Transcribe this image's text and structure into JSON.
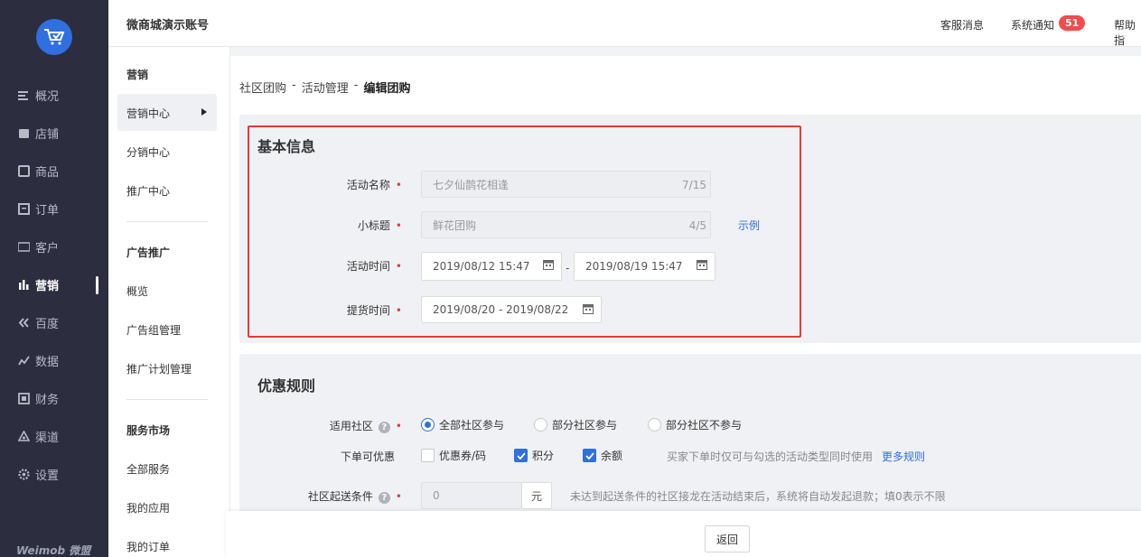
{
  "nav": {
    "items": [
      {
        "label": "概况",
        "icon": "menu-lines-icon"
      },
      {
        "label": "店铺",
        "icon": "store-icon"
      },
      {
        "label": "商品",
        "icon": "goods-icon"
      },
      {
        "label": "订单",
        "icon": "order-icon"
      },
      {
        "label": "客户",
        "icon": "vip-card-icon"
      },
      {
        "label": "营销",
        "icon": "bar-chart-icon"
      },
      {
        "label": "百度",
        "icon": "baidu-icon"
      },
      {
        "label": "数据",
        "icon": "line-chart-icon"
      },
      {
        "label": "财务",
        "icon": "finance-icon"
      },
      {
        "label": "渠道",
        "icon": "channel-icon"
      },
      {
        "label": "设置",
        "icon": "gear-icon"
      }
    ],
    "brand": "Weimob 微盟"
  },
  "header": {
    "account": "微商城演示账号",
    "service": "客服消息",
    "notice": "系统通知",
    "notice_count": "51",
    "help": "帮助指"
  },
  "subnav": {
    "group1": "营销",
    "items1": [
      "营销中心",
      "分销中心",
      "推广中心"
    ],
    "group2": "广告推广",
    "items2": [
      "概览",
      "广告组管理",
      "推广计划管理"
    ],
    "group3": "服务市场",
    "items3": [
      "全部服务",
      "我的应用",
      "我的订单"
    ]
  },
  "breadcrumb": [
    "社区团购",
    "-",
    "活动管理",
    "-",
    "编辑团购"
  ],
  "basic": {
    "title": "基本信息",
    "name_label": "活动名称",
    "name_value": "七夕仙鹊花相逢",
    "name_count": "7/15",
    "subtitle_label": "小标题",
    "subtitle_value": "鲜花团购",
    "subtitle_count": "4/5",
    "example_link": "示例",
    "time_label": "活动时间",
    "time_start": "2019/08/12 15:47",
    "time_sep": "-",
    "time_end": "2019/08/19 15:47",
    "pickup_label": "提货时间",
    "pickup_value": "2019/08/20 - 2019/08/22",
    "required_mark": "•"
  },
  "rules": {
    "title": "优惠规则",
    "community_label": "适用社区",
    "community_options": [
      "全部社区参与",
      "部分社区参与",
      "部分社区不参与"
    ],
    "discount_label": "下单可优惠",
    "discount_options": [
      "优惠券/码",
      "积分",
      "余额"
    ],
    "discount_note": "买家下单时仅可与勾选的活动类型同时使用",
    "more_rules": "更多规则",
    "min_label": "社区起送条件",
    "min_value": "0",
    "min_unit": "元",
    "min_note": "未达到起送条件的社区接龙在活动结束后，系统将自动发起退款；填0表示不限"
  },
  "footer": {
    "back": "返回"
  },
  "colors": {
    "accent": "#2f6fe0",
    "highlight": "#e53935",
    "nav_bg": "#2c2d3e"
  }
}
